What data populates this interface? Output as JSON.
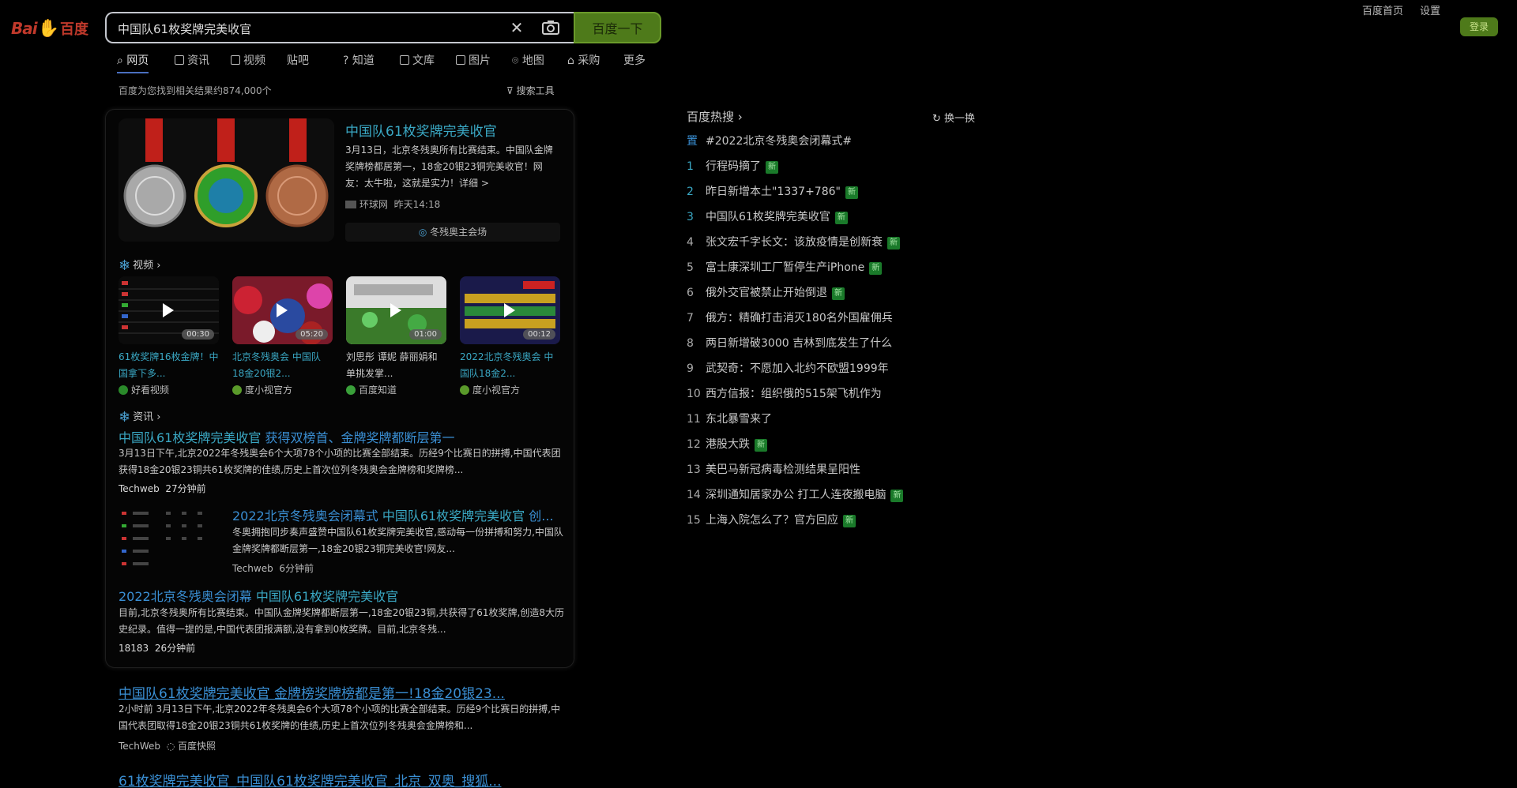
{
  "search": {
    "query": "中国队61枚奖牌完美收官",
    "button_label": "百度一下"
  },
  "logo": {
    "bai": "Bai",
    "du": "百度"
  },
  "top_links": {
    "home": "百度首页",
    "settings": "设置",
    "login": "登录"
  },
  "tabs": [
    "网页",
    "资讯",
    "视频",
    "贴吧",
    "知道",
    "文库",
    "图片",
    "地图",
    "采购",
    "更多"
  ],
  "result_count": "百度为您找到相关结果约874,000个",
  "search_tools": "搜索工具",
  "highlight": {
    "title": "中国队61枚奖牌完美收官",
    "text": "3月13日，北京冬残奥所有比赛结束。中国队金牌奖牌榜都居第一，18金20银23铜完美收官！网友：太牛啦，这就是实力！详细 >",
    "source": "环球网",
    "time": "昨天14:18",
    "theme": "冬残奥主会场"
  },
  "video_section": {
    "heading": "视频",
    "videos": [
      {
        "title": "61枚奖牌16枚金牌！中国拿下多...",
        "source": "好看视频",
        "duration": "00:30"
      },
      {
        "title": "北京冬残奥会 中国队18金20银2...",
        "source": "度小视官方",
        "duration": "05:20"
      },
      {
        "title": "刘思彤 谭妮 薛丽娟和单挑发掌...",
        "source": "百度知道",
        "duration": "01:00"
      },
      {
        "title": "2022北京冬残奥会 中国队18金2...",
        "source": "度小视官方",
        "duration": "00:12"
      }
    ]
  },
  "news_section": {
    "heading": "资讯",
    "items": [
      {
        "title_a": "中国队61枚奖牌完美收官",
        "title_b": " 获得双榜首、金牌奖牌都断层第一",
        "text": "3月13日下午,北京2022年冬残奥会6个大项78个小项的比赛全部结束。历经9个比赛日的拼搏,中国代表团获得18金20银23铜共61枚奖牌的佳绩,历史上首次位列冬残奥会金牌榜和奖牌榜...",
        "source": "Techweb",
        "time": "27分钟前"
      },
      {
        "title_a": "2022北京冬残奥会闭幕式 ",
        "title_b": "中国队61枚奖牌完美收官",
        "title_c": " 创...",
        "text": "冬奥拥抱同步奏声盛赞中国队61枚奖牌完美收官,感动每一份拼搏和努力,中国队金牌奖牌都断层第一,18金20银23铜完美收官!网友...",
        "source": "Techweb",
        "time": "6分钟前"
      },
      {
        "title_a": "2022北京冬残奥会闭幕 ",
        "title_b": "中国队61枚奖牌完美收官",
        "text": "目前,北京冬残奥所有比赛结束。中国队金牌奖牌都断层第一,18金20银23铜,共获得了61枚奖牌,创造8大历史纪录。值得一提的是,中国代表团报满额,没有拿到0枚奖牌。目前,北京冬残...",
        "source": "18183",
        "time": "26分钟前"
      }
    ]
  },
  "results": [
    {
      "title": "中国队61枚奖牌完美收官 金牌榜奖牌榜都是第一!18金20银23...",
      "text_a": "2小时前 3月13日下午,北京2022年冬残奥会6个大项78个小项的比赛全部结束。历经9个比赛日的拼搏,",
      "text_b": "中国代表团取得18金20银23铜共61枚奖牌的佳绩,历史上首次位列冬残奥会金牌榜和...",
      "source": "TechWeb",
      "snapshot": "百度快照"
    },
    {
      "title": "61枚奖牌完美收官_中国队61枚奖牌完美收官_北京_双奥_搜狐..."
    }
  ],
  "hot": {
    "heading": "百度热搜",
    "refresh": "换一换",
    "items": [
      {
        "rank": "置",
        "text": "#2022北京冬残奥会闭幕式#",
        "new": false
      },
      {
        "rank": "1",
        "text": "行程码摘了",
        "new": true
      },
      {
        "rank": "2",
        "text": "昨日新增本土\"1337+786\"",
        "new": true
      },
      {
        "rank": "3",
        "text": "中国队61枚奖牌完美收官",
        "new": true
      },
      {
        "rank": "4",
        "text": "张文宏千字长文：该放疫情是创新衰",
        "new": true
      },
      {
        "rank": "5",
        "text": "富士康深圳工厂暂停生产iPhone",
        "new": true
      },
      {
        "rank": "6",
        "text": "俄外交官被禁止开始倒退",
        "new": true
      },
      {
        "rank": "7",
        "text": "俄方：精确打击消灭180名外国雇佣兵",
        "new": false
      },
      {
        "rank": "8",
        "text": "两日新增破3000 吉林到底发生了什么",
        "new": false
      },
      {
        "rank": "9",
        "text": "武契奇：不愿加入北约不欧盟1999年",
        "new": false
      },
      {
        "rank": "10",
        "text": "西方信报：组织俄的515架飞机作为",
        "new": false
      },
      {
        "rank": "11",
        "text": "东北暴雪来了",
        "new": false
      },
      {
        "rank": "12",
        "text": "港股大跌",
        "new": true
      },
      {
        "rank": "13",
        "text": "美巴马新冠病毒检测结果呈阳性",
        "new": false
      },
      {
        "rank": "14",
        "text": "深圳通知居家办公 打工人连夜搬电脑",
        "new": true
      },
      {
        "rank": "15",
        "text": "上海入院怎么了？官方回应",
        "new": true
      }
    ],
    "new_label": "新"
  }
}
